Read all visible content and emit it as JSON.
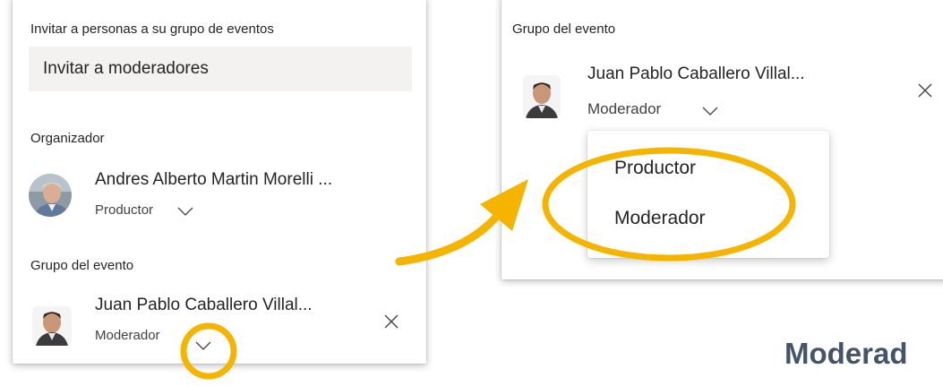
{
  "left_panel": {
    "invite_heading": "Invitar a personas a su grupo de eventos",
    "invite_placeholder": "Invitar a moderadores",
    "organizer_heading": "Organizador",
    "organizer": {
      "name": "Andres Alberto Martin Morelli ...",
      "role": "Productor"
    },
    "group_heading": "Grupo del evento",
    "member": {
      "name": "Juan Pablo Caballero Villal...",
      "role": "Moderador"
    }
  },
  "right_panel": {
    "group_heading": "Grupo del evento",
    "member": {
      "name": "Juan Pablo Caballero Villal...",
      "role": "Moderador"
    },
    "role_options": [
      "Productor",
      "Moderador"
    ]
  },
  "caption": "Moderad",
  "colors": {
    "highlight": "#f5b400",
    "caption": "#44546a",
    "input_bg": "#f3f2f1"
  },
  "icons": [
    "chevron-down-icon",
    "close-icon",
    "arrow-icon",
    "avatar"
  ]
}
